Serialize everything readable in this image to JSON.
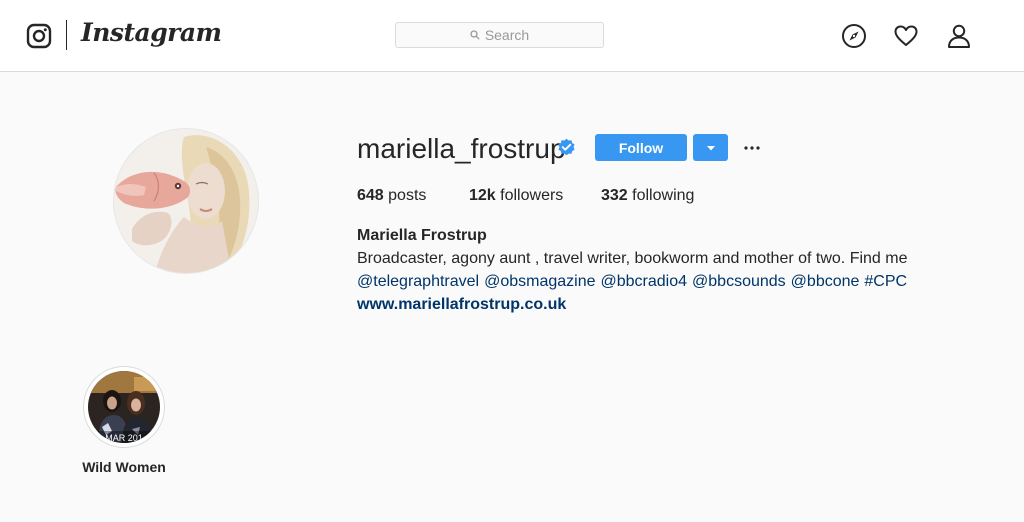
{
  "nav": {
    "brand": "Instagram",
    "search_placeholder": "Search",
    "icons": [
      "camera-logo-icon",
      "search-icon",
      "compass-icon",
      "heart-icon",
      "person-icon"
    ]
  },
  "profile": {
    "username": "mariella_frostrup",
    "verified": true,
    "follow_label": "Follow",
    "stats": {
      "posts_count": "648",
      "posts_label": "posts",
      "followers_count": "12k",
      "followers_label": "followers",
      "following_count": "332",
      "following_label": "following"
    },
    "full_name": "Mariella Frostrup",
    "bio": "Broadcaster, agony aunt , travel writer, bookworm and mother of two. Find me",
    "mentions": [
      "@telegraphtravel",
      "@obsmagazine",
      "@bbcradio4",
      "@bbcsounds",
      "@bbcone",
      "#CPC"
    ],
    "website": "www.mariellafrostrup.co.uk"
  },
  "highlights": [
    {
      "label": "Wild Women",
      "date_overlay": "MAR 201"
    }
  ],
  "colors": {
    "accent": "#3897f0",
    "link": "#003569",
    "verified_badge": "#3897f0",
    "background": "#fafafa",
    "border": "#dbdbdb"
  }
}
